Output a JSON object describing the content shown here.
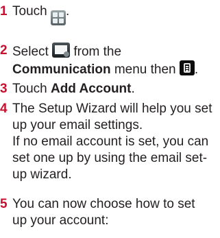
{
  "steps": [
    {
      "num": "1",
      "pre": "Touch ",
      "post": "."
    },
    {
      "num": "2",
      "pre": "Select ",
      "mid": " from the",
      "bold": "Communication",
      "post": " menu then ",
      "end": "."
    },
    {
      "num": "3",
      "pre": "Touch ",
      "bold": "Add Account",
      "post": "."
    },
    {
      "num": "4",
      "lines": [
        "The Setup Wizard will help you set",
        "up your email settings.",
        "If no email account is set, you can",
        "set one up by using the email set-",
        "up wizard."
      ]
    },
    {
      "num": "5",
      "lines": [
        "You can now choose how to set",
        "up your account:"
      ]
    }
  ],
  "icons": {
    "apps": "apps-grid-icon",
    "email": "email-app-icon",
    "menu": "menu-key-icon"
  },
  "colors": {
    "step_number": "#c8102e",
    "text": "#231f20"
  }
}
